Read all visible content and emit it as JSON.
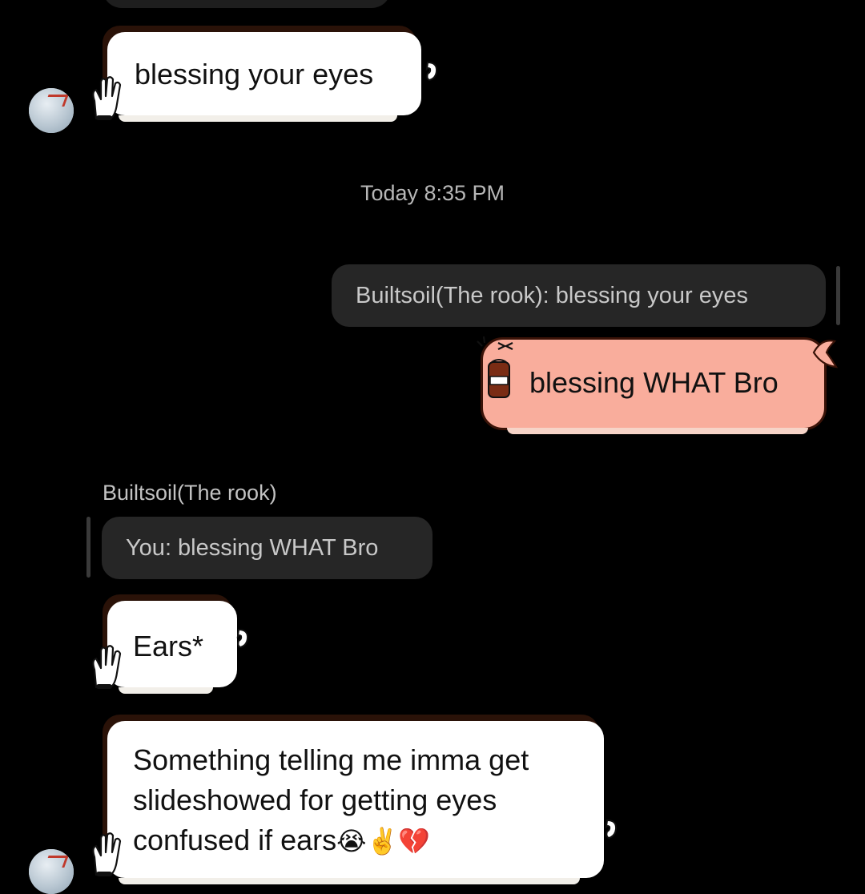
{
  "messages": {
    "msg1": {
      "text": "blessing your eyes"
    },
    "timestamp": "Today 8:35 PM",
    "reply_out": {
      "quoted": "Builtsoil(The rook): blessing your eyes"
    },
    "msg2": {
      "text": "blessing WHAT Bro"
    },
    "sender_name": "Builtsoil(The rook)",
    "reply_in": {
      "quoted": "You: blessing WHAT Bro"
    },
    "msg3": {
      "text": "Ears*"
    },
    "msg4": {
      "line1": "Something telling me imma get",
      "line2": "slideshowed for getting eyes",
      "line3": "confused if ears",
      "emojis": "😭✌️💔"
    }
  },
  "icons": {
    "avatar": "user-avatar",
    "hand": "waving-hand-sticker-icon",
    "can": "soda-can-sticker-icon",
    "bow": "ribbon-bow-icon"
  },
  "colors": {
    "background": "#000000",
    "incoming_bubble": "#ffffff",
    "outgoing_bubble": "#f9ad9c",
    "reply_preview": "#262626",
    "outline": "#2a1208"
  }
}
